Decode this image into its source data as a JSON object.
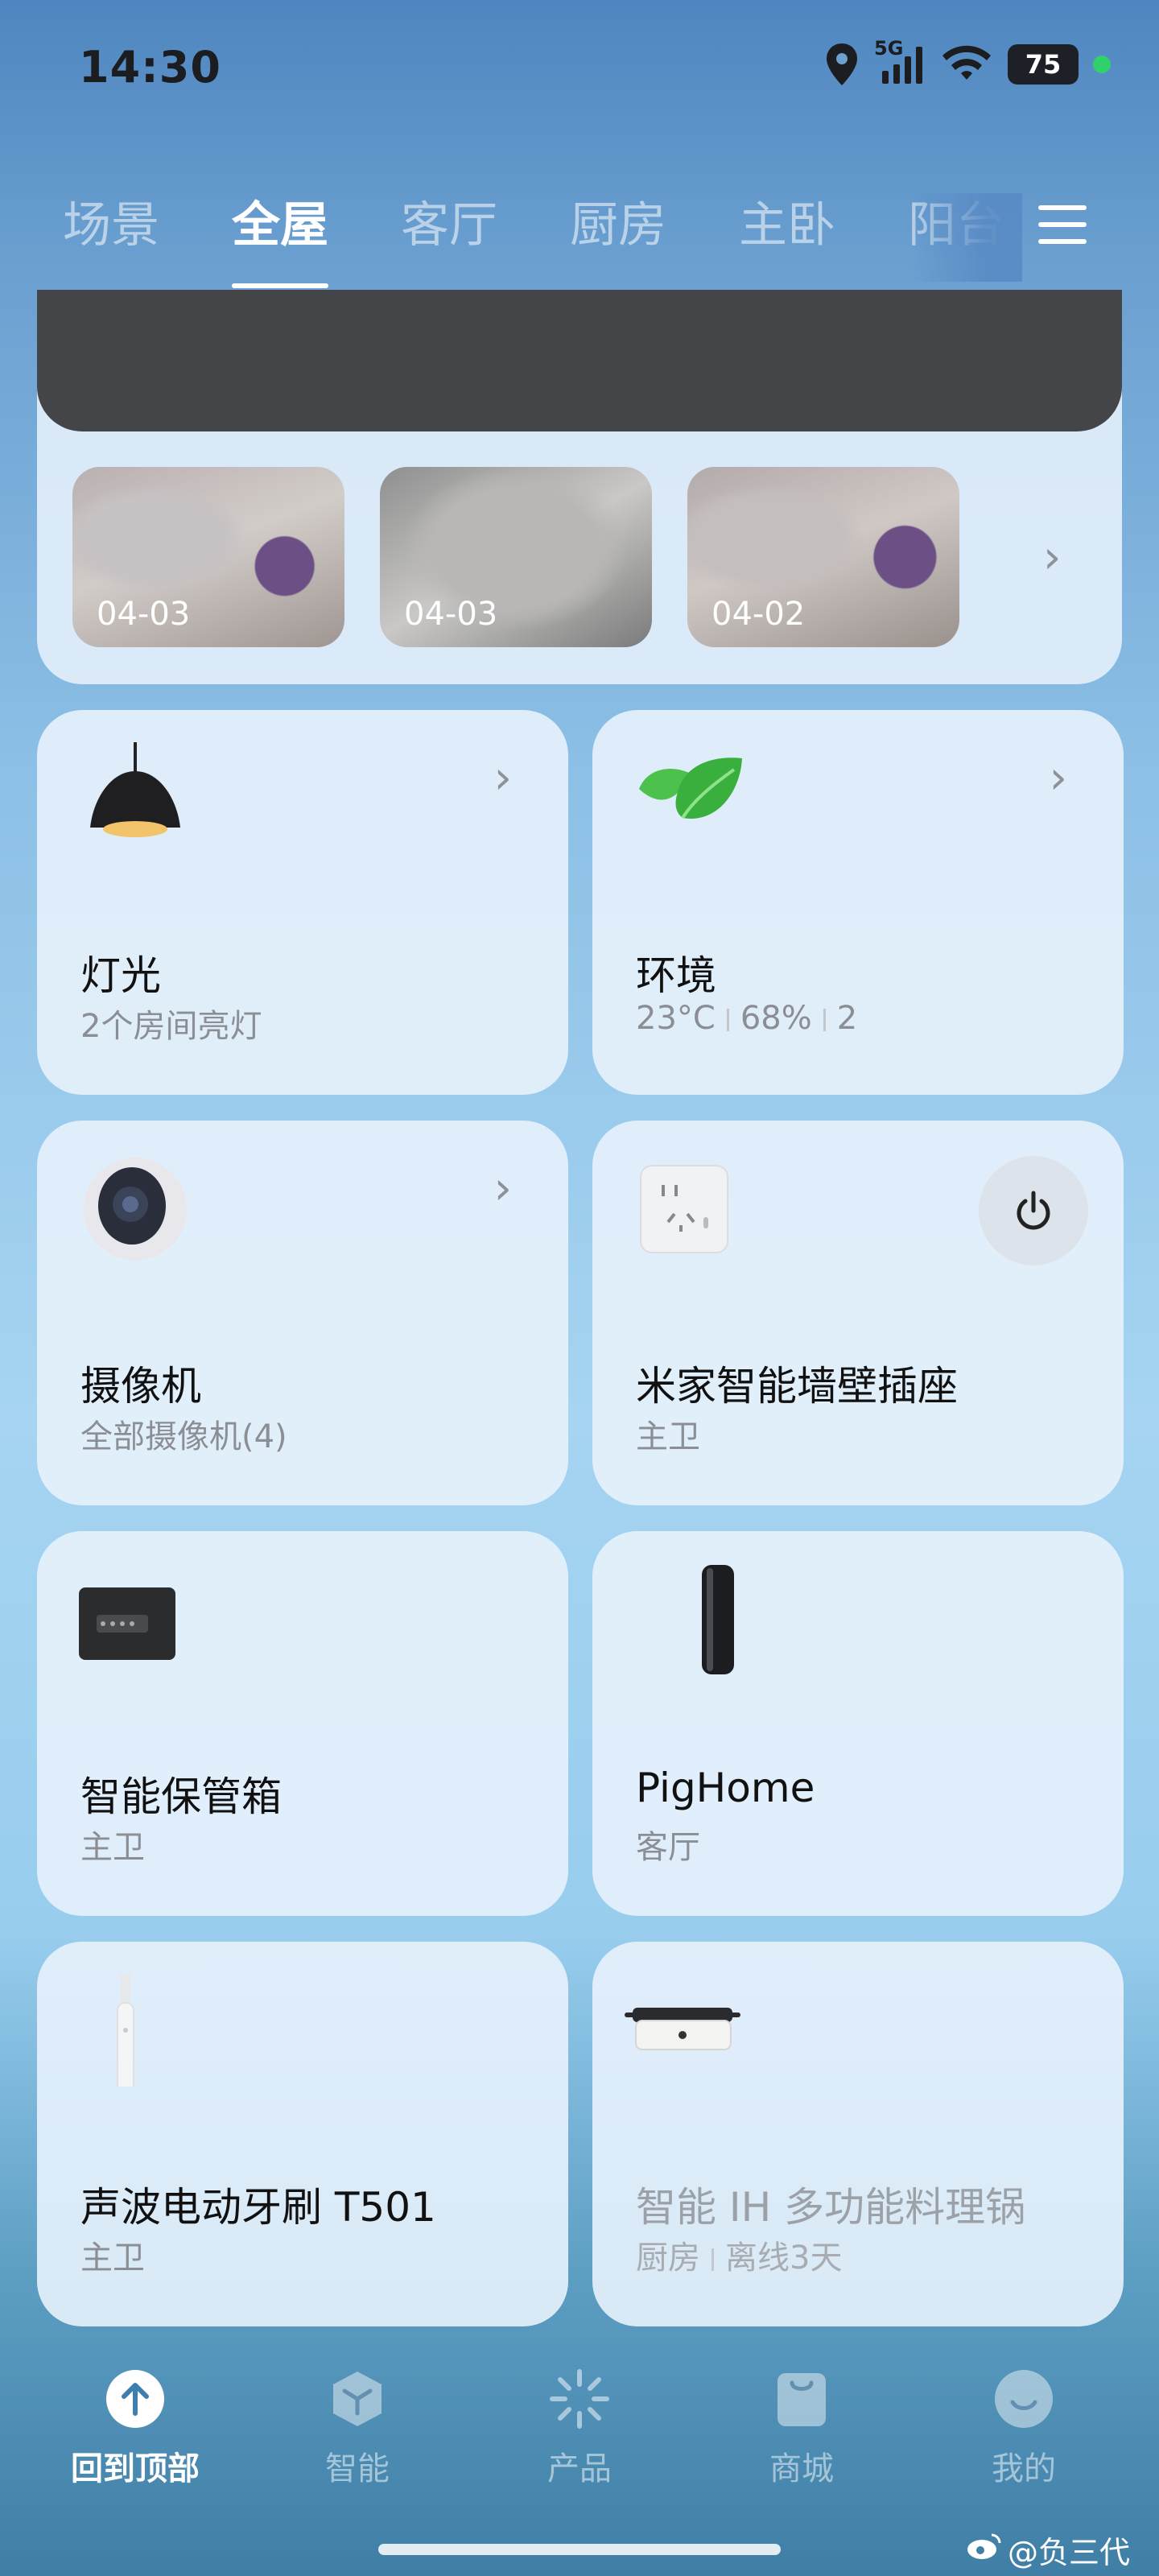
{
  "status_bar": {
    "time": "14:30",
    "network": "5G",
    "battery": "75",
    "icons": [
      "location-icon",
      "signal-icon",
      "wifi-icon",
      "battery-icon"
    ]
  },
  "tabs": [
    {
      "label": "场景",
      "active": false
    },
    {
      "label": "全屋",
      "active": true
    },
    {
      "label": "客厅",
      "active": false
    },
    {
      "label": "厨房",
      "active": false
    },
    {
      "label": "主卧",
      "active": false
    },
    {
      "label": "阳台",
      "active": false
    }
  ],
  "camera": {
    "thumbnails": [
      {
        "date": "04-03"
      },
      {
        "date": "04-03"
      },
      {
        "date": "04-02"
      }
    ]
  },
  "cards": [
    {
      "title": "灯光",
      "subtitle": "2个房间亮灯",
      "icon": "pendant-lamp-icon"
    },
    {
      "title": "环境",
      "subtitle_parts": [
        "23°C",
        "68%",
        "2"
      ],
      "icon": "leaf-icon"
    },
    {
      "title": "摄像机",
      "subtitle": "全部摄像机(4)",
      "icon": "camera-icon"
    },
    {
      "title": "米家智能墙壁插座",
      "subtitle": "主卫",
      "icon": "wall-socket-icon"
    },
    {
      "title": "智能保管箱",
      "subtitle": "主卫",
      "icon": "safe-box-icon"
    },
    {
      "title": "PigHome",
      "subtitle": "客厅",
      "icon": "speaker-icon"
    },
    {
      "title": "声波电动牙刷 T501",
      "subtitle": "主卫",
      "icon": "toothbrush-icon"
    },
    {
      "title": "智能 IH 多功能料理锅",
      "subtitle_parts": [
        "厨房",
        "离线3天"
      ],
      "icon": "cooking-pot-icon",
      "offline": true
    }
  ],
  "bottom_nav": [
    {
      "label": "回到顶部",
      "icon": "arrow-up-icon",
      "active": true
    },
    {
      "label": "智能",
      "icon": "cube-icon",
      "active": false
    },
    {
      "label": "产品",
      "icon": "sparkle-icon",
      "active": false
    },
    {
      "label": "商城",
      "icon": "shopping-bag-icon",
      "active": false
    },
    {
      "label": "我的",
      "icon": "smile-icon",
      "active": false
    }
  ],
  "watermark": "@负三代"
}
